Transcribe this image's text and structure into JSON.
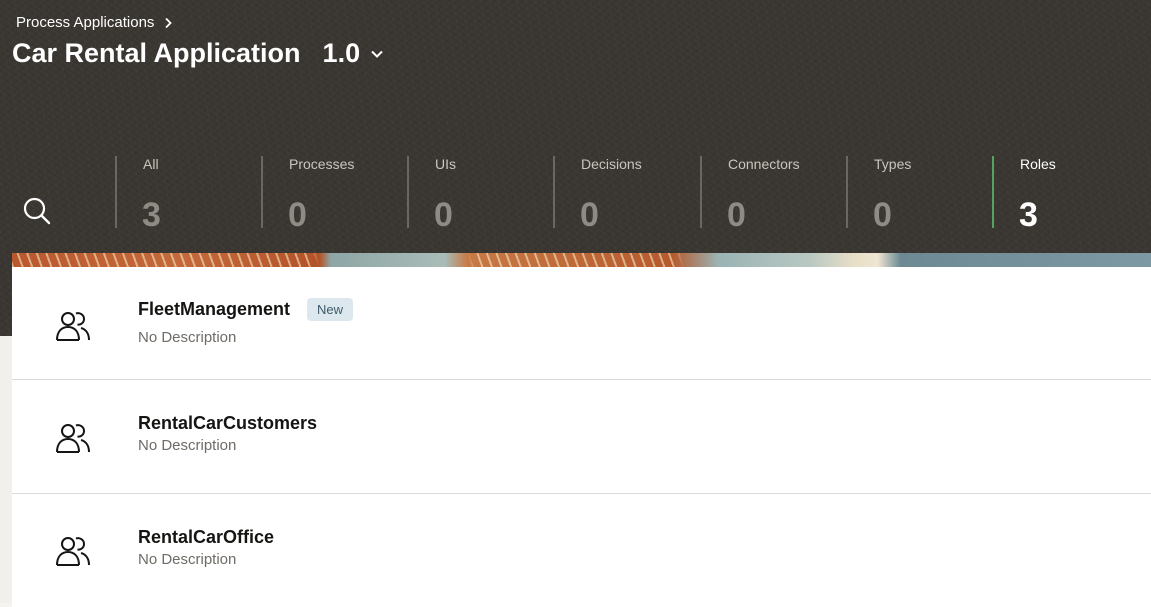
{
  "breadcrumb": {
    "label": "Process Applications"
  },
  "app": {
    "title": "Car Rental Application",
    "version": "1.0"
  },
  "stats": [
    {
      "label": "All",
      "count": "3"
    },
    {
      "label": "Processes",
      "count": "0"
    },
    {
      "label": "UIs",
      "count": "0"
    },
    {
      "label": "Decisions",
      "count": "0"
    },
    {
      "label": "Connectors",
      "count": "0"
    },
    {
      "label": "Types",
      "count": "0"
    },
    {
      "label": "Roles",
      "count": "3",
      "active": true
    }
  ],
  "roles": [
    {
      "name": "FleetManagement",
      "badge": "New",
      "description": "No Description",
      "icon": "people-icon"
    },
    {
      "name": "RentalCarCustomers",
      "description": "No Description",
      "icon": "people-icon"
    },
    {
      "name": "RentalCarOffice",
      "description": "No Description",
      "icon": "people-icon"
    }
  ],
  "colors": {
    "header_bg": "#3a3631",
    "active_accent": "#5aa05e",
    "badge_bg": "#dce8ee"
  }
}
